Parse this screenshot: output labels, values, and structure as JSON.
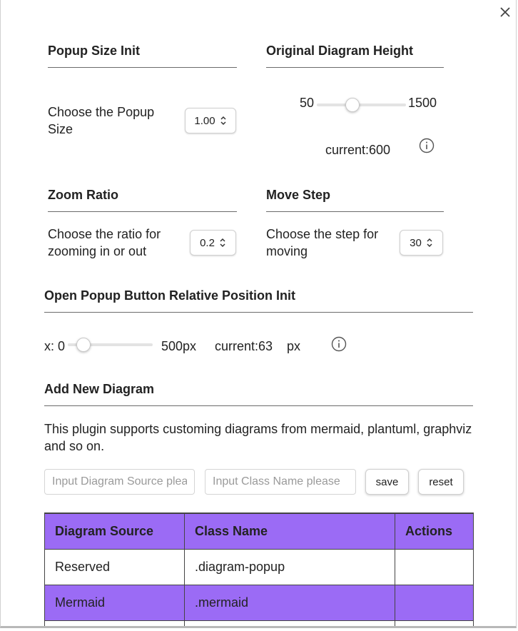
{
  "popup_size": {
    "heading": "Popup Size Init",
    "label": "Choose the Popup Size",
    "value": "1.00"
  },
  "diagram_height": {
    "heading": "Original Diagram Height",
    "min_label": "50",
    "max_label": "1500",
    "min": 50,
    "max": 1500,
    "value": 600,
    "current_text": "current:600"
  },
  "zoom_ratio": {
    "heading": "Zoom Ratio",
    "label": "Choose the ratio for zooming in or out",
    "value": "0.2"
  },
  "move_step": {
    "heading": "Move Step",
    "label": "Choose the step for moving",
    "value": "30"
  },
  "button_position": {
    "heading": "Open Popup Button Relative Position Init",
    "x_label": "x: 0",
    "max_label": "500px",
    "min": 0,
    "max": 500,
    "value": 63,
    "current_text": "current:63",
    "unit": "px"
  },
  "add_diagram": {
    "heading": "Add New Diagram",
    "description": "This plugin supports customing diagrams from mermaid, plantuml, graphviz and so on.",
    "source_placeholder": "Input Diagram Source please",
    "class_placeholder": "Input Class Name please",
    "save_label": "save",
    "reset_label": "reset"
  },
  "table": {
    "headers": [
      "Diagram Source",
      "Class Name",
      "Actions"
    ],
    "rows": [
      {
        "source": "Reserved",
        "class_name": ".diagram-popup",
        "actions": ""
      },
      {
        "source": "Mermaid",
        "class_name": ".mermaid",
        "actions": ""
      },
      {
        "source": "",
        "class_name": "",
        "actions": ""
      }
    ]
  },
  "colors": {
    "accent": "#9b6bf5",
    "rule": "#6b6b6b"
  },
  "icons": {
    "close": "close-icon",
    "info": "info-icon",
    "stepper": "chevron-up-down-icon"
  }
}
